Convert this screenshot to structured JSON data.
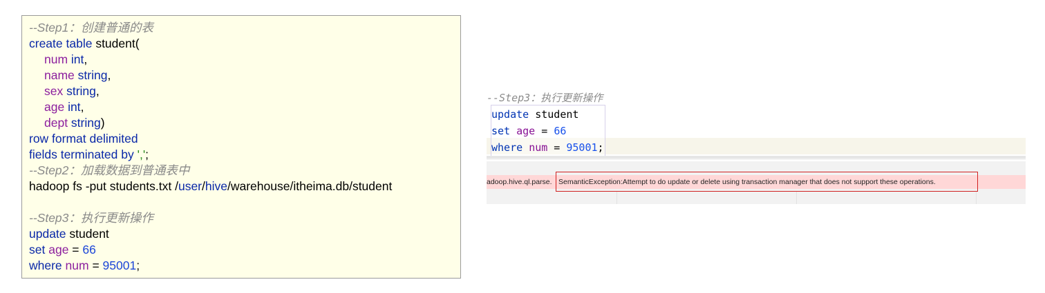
{
  "code_panel": {
    "lines": {
      "l1": {
        "comment": "--Step1：创建普通的表"
      },
      "l2": {
        "kw1": "create table",
        "text": " student("
      },
      "l3": {
        "field": "num",
        "kw": " int",
        "punct": ","
      },
      "l4": {
        "field": "name",
        "kw": " string",
        "punct": ","
      },
      "l5": {
        "field": "sex",
        "kw": " string",
        "punct": ","
      },
      "l6": {
        "field": "age",
        "kw": " int",
        "punct": ","
      },
      "l7": {
        "field": "dept",
        "kw": " string",
        "punct": ")"
      },
      "l8": {
        "kw": "row format delimited"
      },
      "l9": {
        "kw": "fields terminated by",
        "sp": " ",
        "str": "','",
        "punct": ";"
      },
      "l10": {
        "comment": "--Step2：加载数据到普通表中"
      },
      "l11": {
        "t1": "hadoop fs -put students.txt /",
        "kw1": "user",
        "t2": "/",
        "kw2": "hive",
        "t3": "/warehouse/itheima.db/student"
      },
      "l12": {
        "comment": "--Step3：执行更新操作"
      },
      "l13": {
        "kw": "update",
        "text": " student"
      },
      "l14": {
        "kw": "set",
        "sp": " ",
        "field": "age",
        "op": " = ",
        "num": "66"
      },
      "l15": {
        "kw": "where",
        "sp": " ",
        "field": "num",
        "op": " = ",
        "num": "95001",
        "punct": ";"
      }
    }
  },
  "ide": {
    "comment": "--Step3：执行更新操作",
    "line1": {
      "kw": "update",
      "text": " student"
    },
    "line2": {
      "kw": "set",
      "sp": " ",
      "field": "age",
      "op": " = ",
      "num": "66"
    },
    "line3": {
      "kw": "where",
      "sp": " ",
      "field": "num",
      "op": " = ",
      "num": "95001",
      "punct": ";"
    },
    "error": {
      "prefix": "adoop.hive.ql.parse.",
      "message": "SemanticException:Attempt to do update or delete using transaction manager that does not support these operations."
    }
  },
  "colors": {
    "keyword": "#0a28a8",
    "field": "#8c1f9e",
    "number": "#1c46d8",
    "string": "#2a8a1e",
    "comment": "#8a8a8a",
    "error_border": "#d02020",
    "error_bg": "#ffd7d7"
  }
}
